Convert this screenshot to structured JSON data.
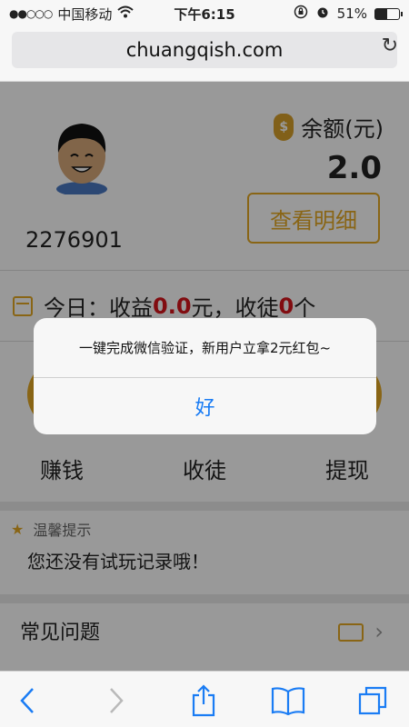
{
  "status_bar": {
    "carrier": "中国移动",
    "time": "下午6:15",
    "battery_percent": "51%",
    "battery_level": 0.51
  },
  "browser": {
    "url": "chuangqish.com"
  },
  "profile": {
    "user_id": "2276901",
    "balance_label": "余额(元)",
    "balance_value": "2.0",
    "detail_button": "查看明细"
  },
  "today": {
    "prefix": "今日：收益",
    "income": "0.0",
    "middle": "元，收徒",
    "apprentices": "0",
    "suffix": "个"
  },
  "actions": [
    {
      "label": "赚钱"
    },
    {
      "label": "收徒"
    },
    {
      "label": "提现"
    }
  ],
  "tips": {
    "title": "温馨提示",
    "text": "您还没有试玩记录哦！"
  },
  "faq": {
    "label": "常见问题"
  },
  "alert": {
    "message": "一键完成微信验证，新用户立拿2元红包~",
    "button": "好"
  },
  "colors": {
    "accent": "#e4a823",
    "highlight": "#d8141b",
    "link": "#1a7cf4"
  }
}
